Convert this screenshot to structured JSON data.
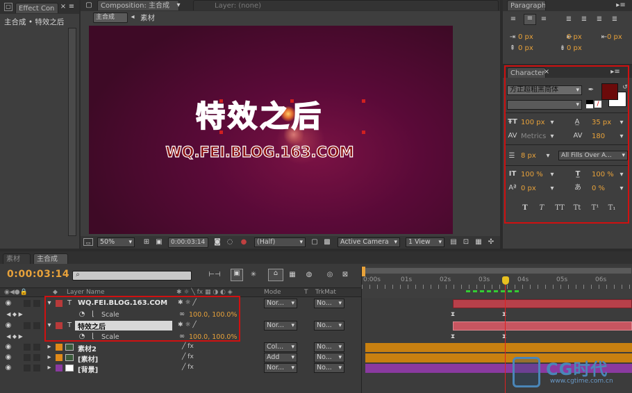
{
  "effect_controls": {
    "tab_label": "Effect Con",
    "path": "主合成 • 特效之后"
  },
  "composition": {
    "tab_label": "Composition: 主合成",
    "layer_tab": "Layer: (none)",
    "breadcrumb": [
      "主合成",
      "素材"
    ],
    "title_text": "特效之后",
    "subtitle_text": "WQ.FEI.BLOG.163.COM",
    "bottom_bar": {
      "zoom": "50%",
      "timecode": "0:00:03:14",
      "resolution": "(Half)",
      "camera": "Active Camera",
      "view": "1 View"
    }
  },
  "paragraph": {
    "tab_label": "Paragraph",
    "values": [
      "0 px",
      "0 px",
      "0 px",
      "0 px",
      "0 px"
    ]
  },
  "character": {
    "tab_label": "Character",
    "font": "方正超粗黑简体",
    "font_style": "",
    "colors": {
      "fill": "#6b0a0a",
      "stroke": "#ffffff"
    },
    "size": "100 px",
    "leading": "35 px",
    "kerning": "Metrics",
    "tracking": "180",
    "stroke_width": "8 px",
    "stroke_mode": "All Fills Over A...",
    "vertical_scale": "100 %",
    "horizontal_scale": "100 %",
    "baseline_shift": "0 px",
    "tsume": "0 %",
    "style_buttons": [
      "T",
      "T",
      "TT",
      "Tt",
      "T¹",
      "T₁"
    ]
  },
  "timeline": {
    "tabs": [
      "素材",
      "主合成"
    ],
    "timecode": "0:00:03:14",
    "search_placeholder": "",
    "columns": {
      "layer_name": "Layer Name",
      "mode": "Mode",
      "t": "T",
      "trkmat": "TrkMat"
    },
    "ruler": [
      "0:00s",
      "01s",
      "02s",
      "03s",
      "04s",
      "05s",
      "06s"
    ],
    "layers": [
      {
        "num": "1",
        "name": "WQ.FEI.BLOG.163.COM",
        "type": "T",
        "color": "#b83a3a",
        "mode": "Nor...",
        "trkmat": "No...",
        "bar": "#c8484c",
        "prop": "Scale",
        "prop_value": "100.0, 100.0%"
      },
      {
        "num": "2",
        "name": "特效之后",
        "type": "T",
        "color": "#b83a3a",
        "mode": "Nor...",
        "trkmat": "No...",
        "bar": "#c8484c",
        "prop": "Scale",
        "prop_value": "100.0, 100.0%"
      },
      {
        "num": "3",
        "name": "素材2",
        "type": "comp",
        "color": "#e08a1a",
        "mode": "Col...",
        "trkmat": "No...",
        "bar": "#c88010"
      },
      {
        "num": "4",
        "name": "[素材]",
        "type": "comp",
        "color": "#e08a1a",
        "mode": "Add",
        "trkmat": "No...",
        "bar": "#c88010"
      },
      {
        "num": "5",
        "name": "[背景]",
        "type": "solid",
        "color": "#8a3aa0",
        "mode": "Nor...",
        "trkmat": "No...",
        "bar": "#8a3aa0"
      }
    ]
  },
  "watermark": {
    "logo_text": "CG时代",
    "url": "www.cgtime.com.cn"
  }
}
